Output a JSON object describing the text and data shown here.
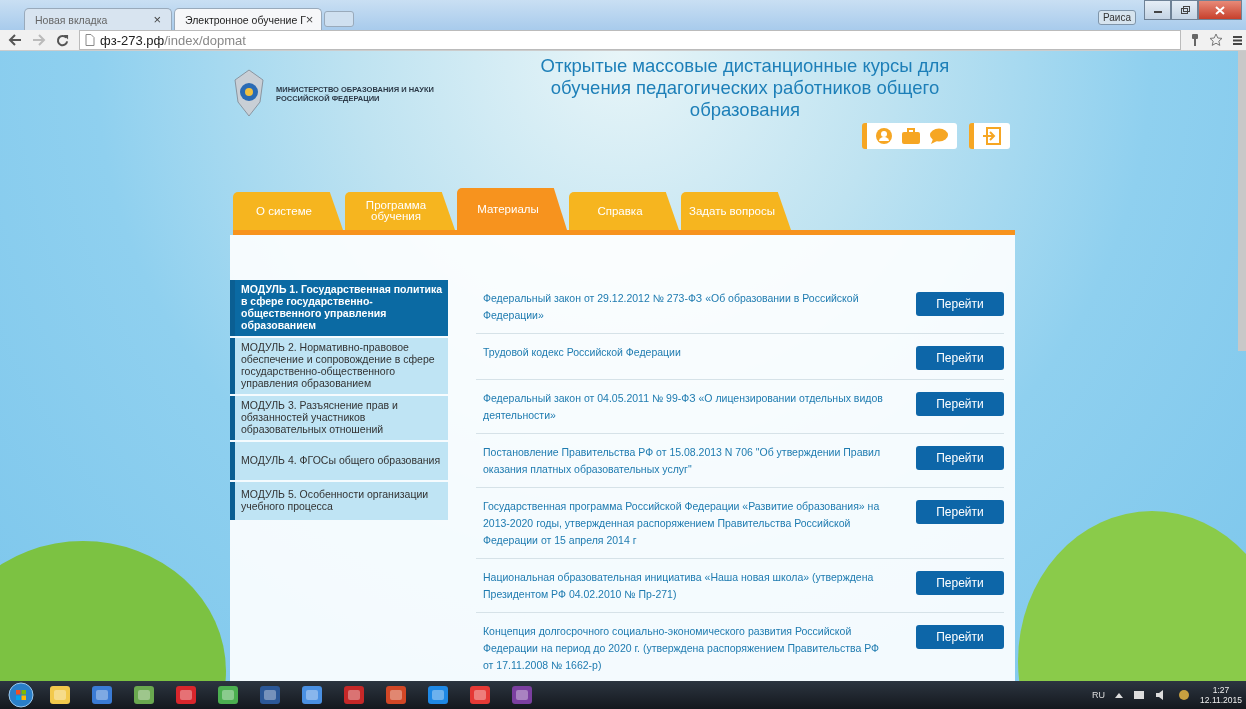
{
  "browser": {
    "tabs": [
      {
        "title": "Новая вкладка",
        "close": "×",
        "selected": false
      },
      {
        "title": "Электронное обучение Г",
        "close": "×",
        "selected": true
      }
    ],
    "user_badge": "Раиса",
    "url": {
      "host": "фз-273.рф",
      "path": "/index/dopmat"
    }
  },
  "site": {
    "ministry": [
      "МИНИСТЕРСТВО ОБРАЗОВАНИЯ И НАУКИ",
      "РОССИЙСКОЙ ФЕДЕРАЦИИ"
    ],
    "title": "Открытые массовые дистанционные курсы для обучения педагогических работников общего образования",
    "nav": [
      {
        "label": "О системе",
        "selected": false
      },
      {
        "label": "Программа обучения",
        "selected": false
      },
      {
        "label": "Материалы",
        "selected": true
      },
      {
        "label": "Справка",
        "selected": false
      },
      {
        "label": "Задать вопросы",
        "selected": false
      }
    ],
    "modules": [
      {
        "label": "МОДУЛЬ 1. Государственная политика в сфере государственно-общественного управления образованием",
        "selected": true
      },
      {
        "label": "МОДУЛЬ 2. Нормативно-правовое обеспечение и сопровождение в сфере государственно-общественного управления образованием",
        "selected": false
      },
      {
        "label": "МОДУЛЬ 3. Разъяснение прав и обязанностей участников образовательных отношений",
        "selected": false
      },
      {
        "label": "МОДУЛЬ 4. ФГОСы общего образования",
        "selected": false
      },
      {
        "label": "МОДУЛЬ 5. Особенности организации учебного процесса",
        "selected": false
      }
    ],
    "documents": [
      {
        "title": "Федеральный закон от 29.12.2012 № 273-ФЗ «Об образовании в Российской Федерации»",
        "button": "Перейти"
      },
      {
        "title": "Трудовой кодекс Российской Федерации",
        "button": "Перейти"
      },
      {
        "title": "Федеральный закон от 04.05.2011 № 99-ФЗ «О лицензировании отдельных видов деятельности»",
        "button": "Перейти"
      },
      {
        "title": "Постановление Правительства РФ от 15.08.2013 N 706 \"Об утверждении Правил оказания платных образовательных услуг\"",
        "button": "Перейти"
      },
      {
        "title": "Государственная программа Российской Федерации «Развитие образования» на 2013-2020 годы, утвержденная распоряжением Правительства Российской Федерации от 15 апреля 2014 г",
        "button": "Перейти"
      },
      {
        "title": "Национальная образовательная инициатива «Наша новая школа» (утверждена Президентом РФ 04.02.2010 № Пр-271)",
        "button": "Перейти"
      },
      {
        "title": "Концепция долгосрочного социально-экономического развития Российской Федерации на период до 2020 г. (утверждена распоряжением Правительства РФ от 17.11.2008 № 1662-р)",
        "button": "Перейти"
      }
    ]
  },
  "taskbar": {
    "language": "RU",
    "time": "1:27",
    "date": "12.11.2015"
  }
}
